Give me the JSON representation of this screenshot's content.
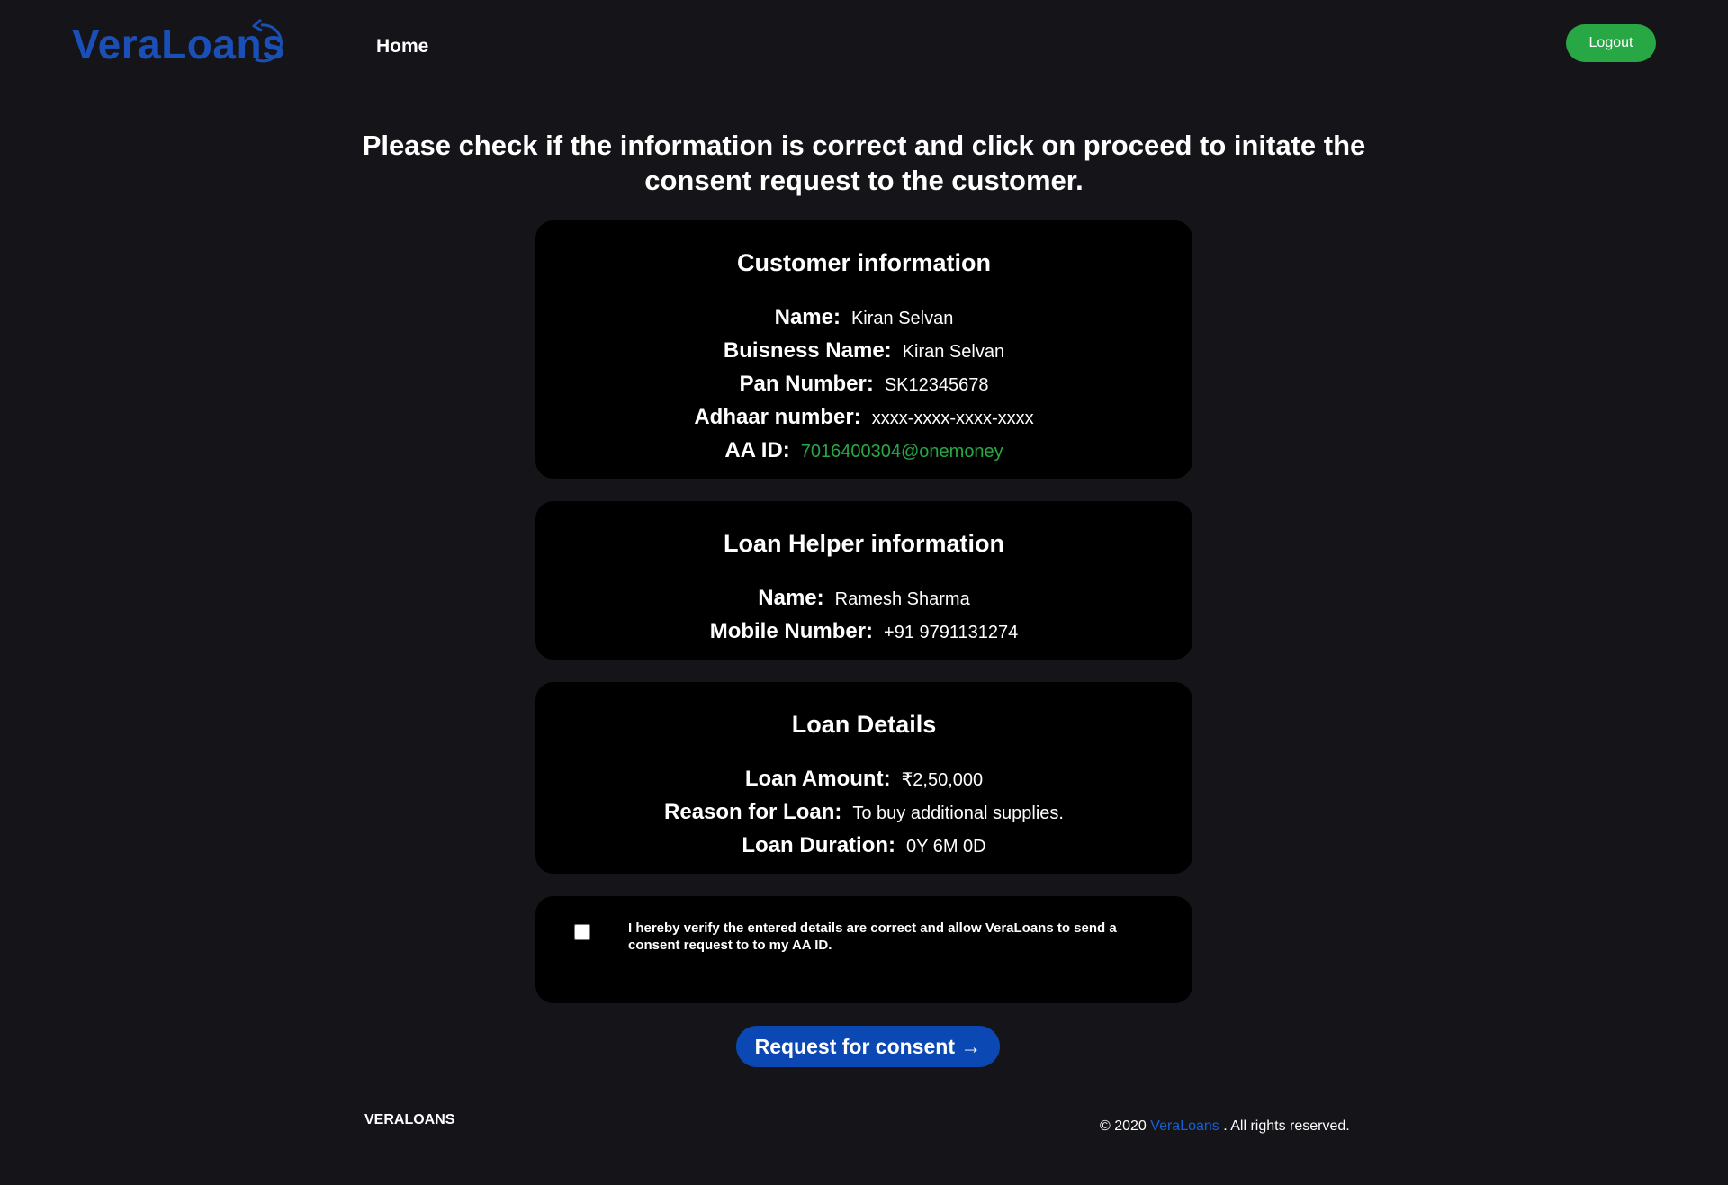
{
  "header": {
    "logo_text": "VeraLoans",
    "nav_home": "Home",
    "logout_label": "Logout"
  },
  "instruction": "Please check if the information is correct and click on proceed to initate the consent request to the customer.",
  "customer": {
    "title": "Customer information",
    "rows": [
      {
        "label": "Name:",
        "value": "Kiran Selvan"
      },
      {
        "label": "Buisness Name:",
        "value": "Kiran Selvan"
      },
      {
        "label": "Pan Number:",
        "value": "SK12345678"
      },
      {
        "label": "Adhaar number:",
        "value": "xxxx-xxxx-xxxx-xxxx"
      },
      {
        "label": "AA ID:",
        "value": "7016400304@onemoney"
      }
    ]
  },
  "helper": {
    "title": "Loan Helper information",
    "rows": [
      {
        "label": "Name:",
        "value": "Ramesh Sharma"
      },
      {
        "label": "Mobile Number:",
        "value": "+91 9791131274"
      }
    ]
  },
  "loan": {
    "title": "Loan Details",
    "rows": [
      {
        "label": "Loan Amount:",
        "value": "₹2,50,000"
      },
      {
        "label": "Reason for Loan:",
        "value": "To buy additional supplies."
      },
      {
        "label": "Loan Duration:",
        "value": "0Y 6M 0D"
      }
    ]
  },
  "consent": {
    "text": "I hereby verify the entered details are correct and allow VeraLoans to send a consent request to to my AA ID.",
    "button_label": "Request for consent →"
  },
  "footer": {
    "brand": "VERALOANS",
    "copy_prefix": "© 2020 ",
    "copy_link": "VeraLoans",
    "copy_suffix": " . All rights reserved."
  },
  "colors": {
    "background": "#151519",
    "card": "#000000",
    "brand_blue": "#1a4fb8",
    "button_blue": "#0c48b3",
    "green": "#28a745"
  }
}
